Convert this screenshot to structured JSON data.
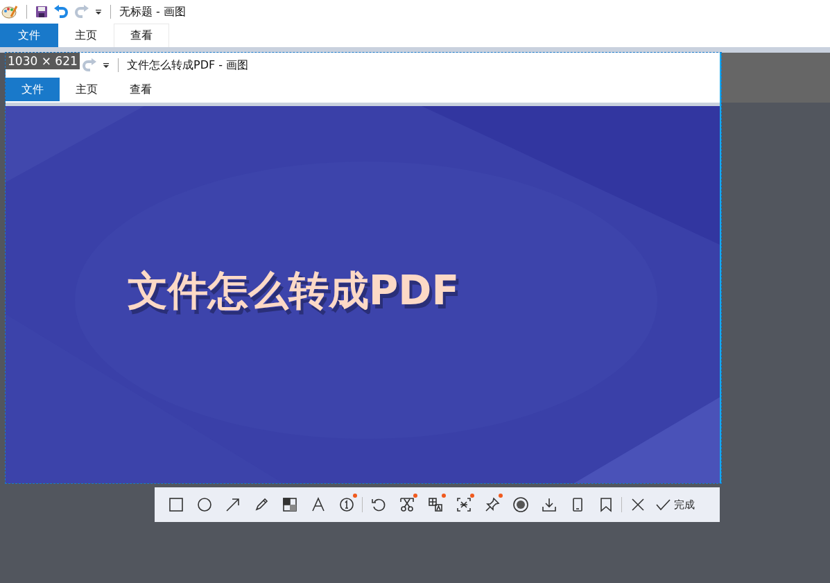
{
  "window": {
    "title": "无标题 - 画图"
  },
  "tabs": [
    {
      "label": "文件",
      "selected": true
    },
    {
      "label": "主页",
      "selected": false
    },
    {
      "label": "查看",
      "selected": false
    }
  ],
  "capture": {
    "size_label": "1030 × 621",
    "window": {
      "title": "文件怎么转成PDF - 画图"
    },
    "tabs": [
      {
        "label": "文件",
        "selected": true
      },
      {
        "label": "主页",
        "selected": false
      },
      {
        "label": "查看",
        "selected": false
      }
    ],
    "banner_title": "文件怎么转成PDF"
  },
  "toolbar": {
    "tools": [
      {
        "kind": "rectangle",
        "dot": false
      },
      {
        "kind": "ellipse",
        "dot": false
      },
      {
        "kind": "arrow",
        "dot": false
      },
      {
        "kind": "pencil",
        "dot": false
      },
      {
        "kind": "mosaic",
        "dot": false
      },
      {
        "kind": "text",
        "dot": false
      },
      {
        "kind": "number",
        "dot": true
      },
      {
        "kind": "separator"
      },
      {
        "kind": "undo",
        "dot": false
      },
      {
        "kind": "scissors",
        "dot": true
      },
      {
        "kind": "translate",
        "dot": true
      },
      {
        "kind": "ocr",
        "dot": true
      },
      {
        "kind": "pin",
        "dot": true
      },
      {
        "kind": "record",
        "dot": false
      },
      {
        "kind": "download",
        "dot": false
      },
      {
        "kind": "phone",
        "dot": false
      },
      {
        "kind": "bookmark",
        "dot": false
      },
      {
        "kind": "separator"
      },
      {
        "kind": "close",
        "dot": false
      }
    ],
    "done_label": "完成"
  }
}
